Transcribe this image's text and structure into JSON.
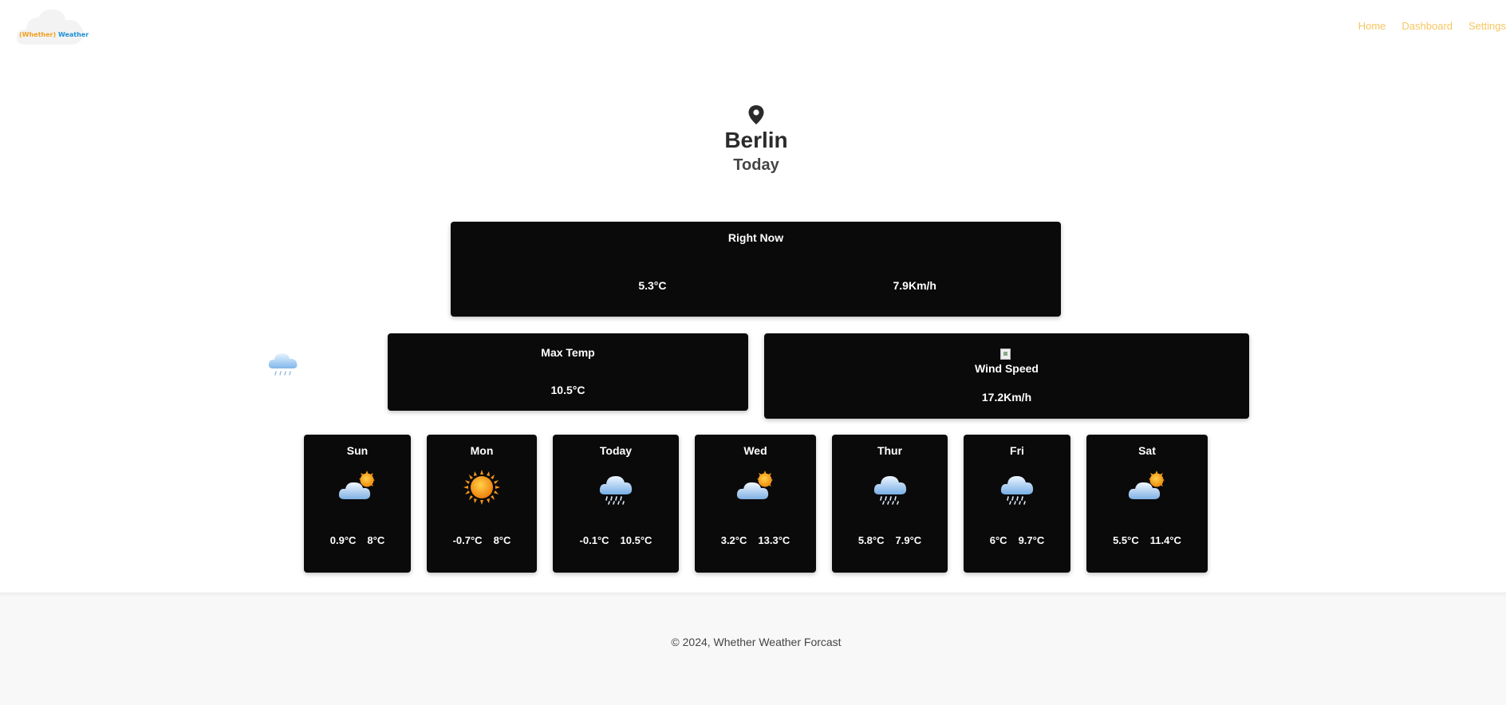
{
  "logo": {
    "part1": "(Whether)",
    "part2": " Weather"
  },
  "nav": {
    "home": "Home",
    "dashboard": "Dashboard",
    "settings": "Settings"
  },
  "location": {
    "city": "Berlin",
    "day": "Today"
  },
  "right_now": {
    "title": "Right Now",
    "temp": "5.3°C",
    "wind": "7.9Km/h"
  },
  "max_temp": {
    "title": "Max Temp",
    "value": "10.5°C"
  },
  "wind_speed": {
    "title": "Wind Speed",
    "value": "17.2Km/h"
  },
  "side_icon": "rain-cloud-icon",
  "forecast": [
    {
      "day": "Sun",
      "icon": "partly-cloudy-icon",
      "low": "0.9°C",
      "high": "8°C"
    },
    {
      "day": "Mon",
      "icon": "sun-icon",
      "low": "-0.7°C",
      "high": "8°C"
    },
    {
      "day": "Today",
      "icon": "rain-cloud-icon",
      "low": "-0.1°C",
      "high": "10.5°C"
    },
    {
      "day": "Wed",
      "icon": "partly-cloudy-icon",
      "low": "3.2°C",
      "high": "13.3°C"
    },
    {
      "day": "Thur",
      "icon": "rain-cloud-icon",
      "low": "5.8°C",
      "high": "7.9°C"
    },
    {
      "day": "Fri",
      "icon": "rain-cloud-icon",
      "low": "6°C",
      "high": "9.7°C"
    },
    {
      "day": "Sat",
      "icon": "partly-cloudy-icon",
      "low": "5.5°C",
      "high": "11.4°C"
    }
  ],
  "footer": {
    "text": "© 2024, Whether Weather Forcast"
  },
  "colors": {
    "nav_link": "#f6c660",
    "card_bg": "#0a0a0a",
    "logo_orange": "#f0a020",
    "logo_blue": "#1e90d6"
  }
}
